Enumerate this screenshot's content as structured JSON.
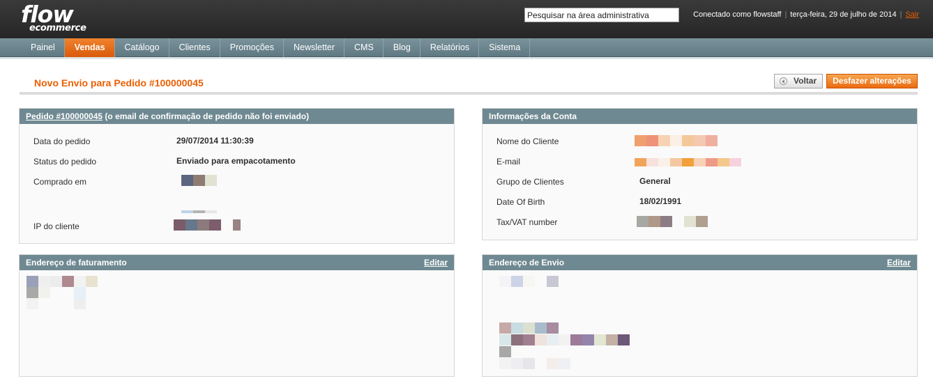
{
  "header": {
    "logo_main": "flow",
    "logo_sub": "ecommerce",
    "search_value": "Pesquisar na área administrativa",
    "logged_in": "Conectado como flowstaff",
    "date": "terça-feira, 29 de julho de 2014",
    "logout": "Sair"
  },
  "nav": {
    "items": [
      "Painel",
      "Vendas",
      "Catálogo",
      "Clientes",
      "Promoções",
      "Newsletter",
      "CMS",
      "Blog",
      "Relatórios",
      "Sistema"
    ],
    "active": "Vendas"
  },
  "page": {
    "title": "Novo Envio para Pedido #100000045",
    "back_button": "Voltar",
    "undo_button": "Desfazer alterações"
  },
  "order_box": {
    "order_link": "Pedido #100000045",
    "header_note": "(o email de confirmação de pedido não foi enviado)",
    "rows": [
      {
        "label": "Data do pedido",
        "value": "29/07/2014 11:30:39"
      },
      {
        "label": "Status do pedido",
        "value": "Enviado para empacotamento"
      },
      {
        "label": "Comprado em",
        "value": ""
      },
      {
        "label": "IP do cliente",
        "value": ""
      }
    ]
  },
  "account_box": {
    "title": "Informações da Conta",
    "rows": [
      {
        "label": "Nome do Cliente",
        "value": ""
      },
      {
        "label": "E-mail",
        "value": ""
      },
      {
        "label": "Grupo de Clientes",
        "value": "General"
      },
      {
        "label": "Date Of Birth",
        "value": "18/02/1991"
      },
      {
        "label": "Tax/VAT number",
        "value": ""
      }
    ]
  },
  "billing_box": {
    "title": "Endereço de faturamento",
    "edit": "Editar"
  },
  "shipping_box": {
    "title": "Endereço de Envio",
    "edit": "Editar"
  },
  "colors": {
    "accent": "#eb5e00",
    "nav": "#6f8992",
    "header": "#2d2d2d"
  }
}
